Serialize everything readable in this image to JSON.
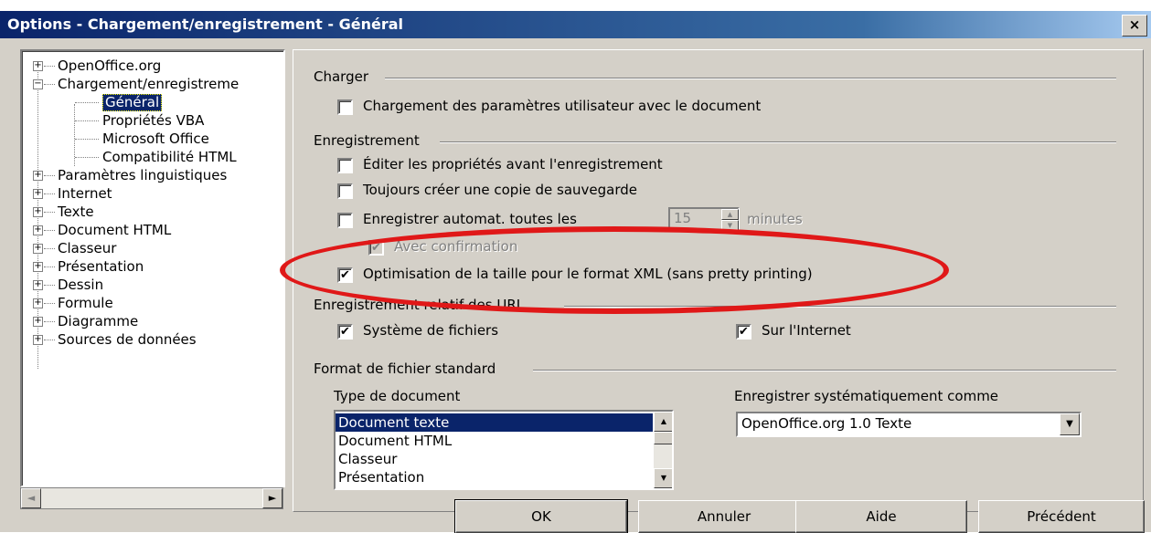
{
  "window": {
    "title": "Options - Chargement/enregistrement - Général",
    "close_glyph": "×"
  },
  "tree": {
    "items": [
      {
        "label": "OpenOffice.org",
        "expander": "+"
      },
      {
        "label": "Chargement/enregistreme",
        "expander": "−"
      },
      {
        "label": "Général",
        "selected": true
      },
      {
        "label": "Propriétés VBA"
      },
      {
        "label": "Microsoft Office"
      },
      {
        "label": "Compatibilité HTML"
      },
      {
        "label": "Paramètres linguistiques",
        "expander": "+"
      },
      {
        "label": "Internet",
        "expander": "+"
      },
      {
        "label": "Texte",
        "expander": "+"
      },
      {
        "label": "Document HTML",
        "expander": "+"
      },
      {
        "label": "Classeur",
        "expander": "+"
      },
      {
        "label": "Présentation",
        "expander": "+"
      },
      {
        "label": "Dessin",
        "expander": "+"
      },
      {
        "label": "Formule",
        "expander": "+"
      },
      {
        "label": "Diagramme",
        "expander": "+"
      },
      {
        "label": "Sources de données",
        "expander": "+"
      }
    ],
    "scroll_left": "◄",
    "scroll_right": "►"
  },
  "charger": {
    "title": "Charger",
    "load_user_settings": {
      "label": "Chargement des paramètres utilisateur avec le document",
      "checked": false
    }
  },
  "enregistrement": {
    "title": "Enregistrement",
    "edit_props": {
      "label": "Éditer les propriétés avant l'enregistrement",
      "checked": false
    },
    "backup_copy": {
      "label": "Toujours créer une copie de sauvegarde",
      "checked": false
    },
    "autosave": {
      "label": "Enregistrer automat. toutes les",
      "checked": false,
      "value": "15",
      "unit": "minutes"
    },
    "confirm": {
      "label": "Avec confirmation",
      "checked": true,
      "disabled": true
    },
    "xml_opt": {
      "label": "Optimisation de la taille pour le format XML (sans pretty printing)",
      "checked": true
    }
  },
  "url": {
    "title": "Enregistrement relatif des URL",
    "filesystem": {
      "label": "Système de fichiers",
      "checked": true
    },
    "internet": {
      "label": "Sur l'Internet",
      "checked": true
    }
  },
  "format": {
    "title": "Format de fichier standard",
    "doc_type_label": "Type de document",
    "doc_types": [
      "Document texte",
      "Document HTML",
      "Classeur",
      "Présentation"
    ],
    "always_save_label": "Enregistrer systématiquement comme",
    "always_save_value": "OpenOffice.org 1.0 Texte"
  },
  "buttons": {
    "ok": "OK",
    "cancel": "Annuler",
    "help": "Aide",
    "back": "Précédent"
  },
  "check_glyph": "✔",
  "colors": {
    "title_bar": "#0a246a",
    "selection": "#0a246a",
    "annotation": "#e01818",
    "dialog": "#d4d0c8"
  }
}
